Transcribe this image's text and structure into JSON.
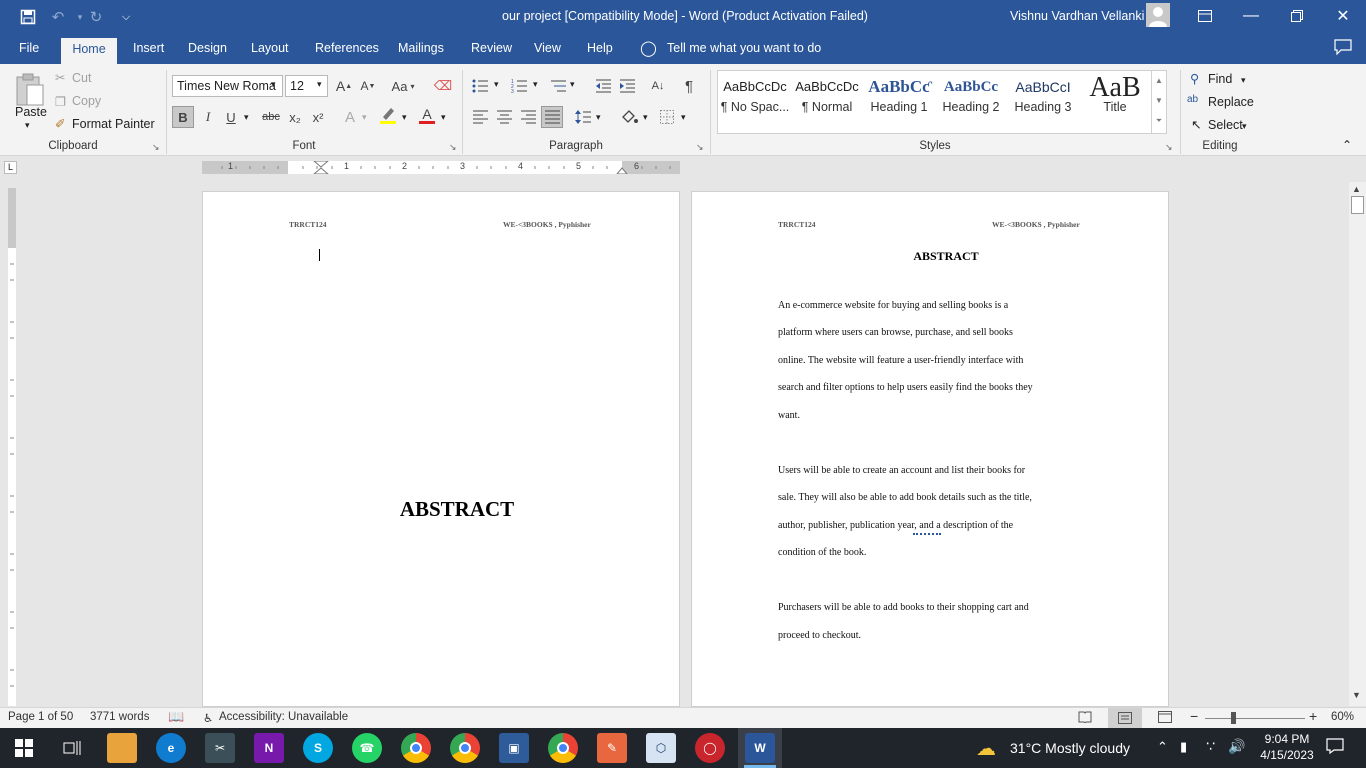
{
  "window": {
    "title": "our project [Compatibility Mode]  -  Word (Product Activation Failed)",
    "user": "Vishnu Vardhan Vellanki"
  },
  "tabs": {
    "file": "File",
    "home": "Home",
    "insert": "Insert",
    "design": "Design",
    "layout": "Layout",
    "references": "References",
    "mailings": "Mailings",
    "review": "Review",
    "view": "View",
    "help": "Help",
    "tell_me": "Tell me what you want to do"
  },
  "clipboard": {
    "paste": "Paste",
    "cut": "Cut",
    "copy": "Copy",
    "format_painter": "Format Painter",
    "label": "Clipboard"
  },
  "font": {
    "family": "Times New Roma",
    "size": "12",
    "label": "Font",
    "bold": "B",
    "italic": "I",
    "underline": "U",
    "strike": "abc",
    "subscript": "x₂",
    "superscript": "x²",
    "change_case": "Aa",
    "grow": "A",
    "shrink": "A",
    "font_color": "A",
    "text_effects": "A"
  },
  "paragraph": {
    "label": "Paragraph",
    "pilcrow": "¶"
  },
  "styles": {
    "label": "Styles",
    "items": [
      {
        "sample": "AaBbCcDc",
        "name": "¶ No Spac...",
        "color": "#222222"
      },
      {
        "sample": "AaBbCcDc",
        "name": "¶ Normal",
        "color": "#222222"
      },
      {
        "sample": "AaBbCƈ",
        "name": "Heading 1",
        "color": "#2f5496"
      },
      {
        "sample": "AaBbCc",
        "name": "Heading 2",
        "color": "#2f5496"
      },
      {
        "sample": "AaBbCcI",
        "name": "Heading 3",
        "color": "#1f3763"
      },
      {
        "sample": "AaB",
        "name": "Title",
        "color": "#222222"
      }
    ]
  },
  "editing": {
    "label": "Editing",
    "find": "Find",
    "replace": "Replace",
    "select": "Select"
  },
  "ruler": {
    "numbers": [
      "1",
      "1",
      "2",
      "3",
      "4",
      "5",
      "6"
    ]
  },
  "page1": {
    "header_left": "TRRCT124",
    "header_right": "WE-<3BOOKS , Pyphisher",
    "heading": "ABSTRACT"
  },
  "page2": {
    "header_left": "TRRCT124",
    "header_right": "WE-<3BOOKS , Pyphisher",
    "heading": "ABSTRACT",
    "lines": [
      "An e-commerce website for buying and selling books is a",
      "platform where users can browse, purchase, and sell books",
      "online. The website will feature a user-friendly interface with",
      "search and filter options to help users easily find the books they",
      "want.",
      "Users will be able to create an account and list their books for",
      "sale. They will also be able to add book details such as the title,",
      "author, publisher, publication year, and a description of the",
      "condition of the book.",
      "Purchasers will be able to add books to their shopping cart and",
      "proceed to checkout."
    ]
  },
  "status": {
    "page": "Page 1 of 50",
    "words": "3771 words",
    "accessibility": "Accessibility: Unavailable",
    "zoom": "60%",
    "zoom_minus": "−",
    "zoom_plus": "+"
  },
  "taskbar": {
    "weather": "31°C  Mostly cloudy",
    "time": "9:04 PM",
    "date": "4/15/2023",
    "accent": "#2b579a"
  }
}
